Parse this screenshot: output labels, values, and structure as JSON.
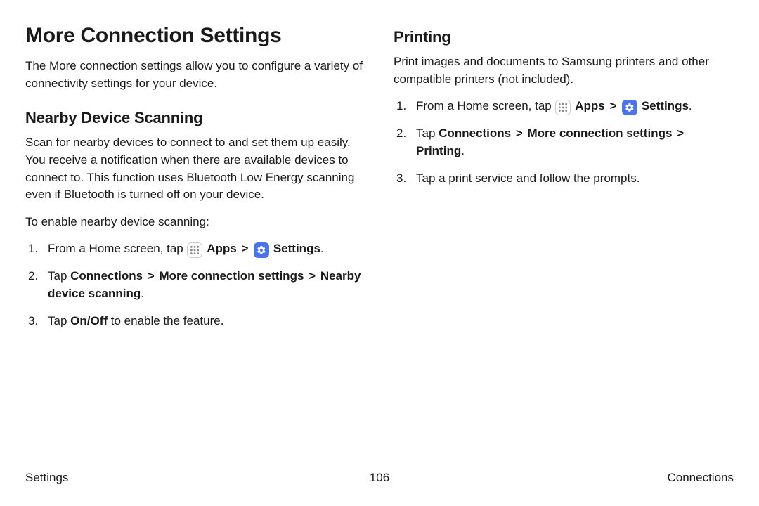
{
  "left": {
    "title": "More Connection Settings",
    "intro": "The More connection settings allow you to configure a variety of connectivity settings for your device.",
    "section_title": "Nearby Device Scanning",
    "section_desc": "Scan for nearby devices to connect to and set them up easily. You receive a notification when there are available devices to connect to. This function uses Bluetooth Low Energy scanning even if Bluetooth is turned off on your device.",
    "enable_intro": "To enable nearby device scanning:",
    "step1_prefix": "From a Home screen, tap ",
    "step1_apps": "Apps",
    "step1_settings": "Settings",
    "step2_prefix": "Tap ",
    "step2_b1": "Connections",
    "step2_b2": "More connection settings",
    "step2_b3": "Nearby device scanning",
    "step3_prefix": "Tap ",
    "step3_b": "On/Off",
    "step3_suffix": " to enable the feature."
  },
  "right": {
    "title": "Printing",
    "intro": "Print images and documents to Samsung printers and other compatible printers (not included).",
    "step1_prefix": "From a Home screen, tap ",
    "step1_apps": "Apps",
    "step1_settings": "Settings",
    "step2_prefix": "Tap ",
    "step2_b1": "Connections",
    "step2_b2": "More connection settings",
    "step2_b3": "Printing",
    "step3": "Tap a print service and follow the prompts."
  },
  "footer": {
    "left": "Settings",
    "center": "106",
    "right": "Connections"
  },
  "glyph": {
    "chevron": ">"
  }
}
